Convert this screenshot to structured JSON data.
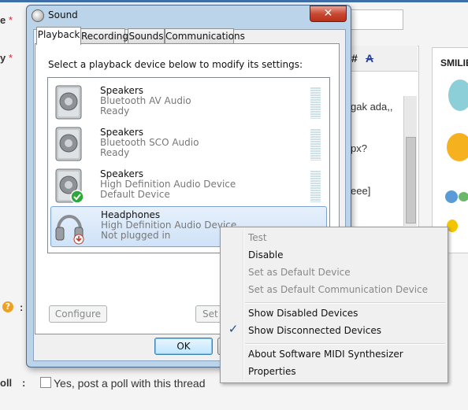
{
  "background": {
    "labels": {
      "row1": "e",
      "row2": "y",
      "req": "*",
      "poll": "oll",
      "colon": ":"
    },
    "title_input_text": "",
    "toolbar": {
      "hash": "#",
      "strike": "A"
    },
    "body_lines": [
      "gak ada,,",
      "px?",
      "eee]"
    ],
    "smilies_heading": "SMILIE",
    "help_icon": "?",
    "poll_option": "Yes, post a poll with this thread"
  },
  "dialog": {
    "title": "Sound",
    "close_label": "✕",
    "tabs": [
      "Playback",
      "Recording",
      "Sounds",
      "Communications"
    ],
    "active_tab": "Playback",
    "instruction": "Select a playback device below to modify its settings:",
    "devices": [
      {
        "name": "Speakers",
        "description": "Bluetooth AV Audio",
        "status": "Ready",
        "icon": "speaker-icon"
      },
      {
        "name": "Speakers",
        "description": "Bluetooth SCO Audio",
        "status": "Ready",
        "icon": "speaker-icon"
      },
      {
        "name": "Speakers",
        "description": "High Definition Audio Device",
        "status": "Default Device",
        "icon": "speaker-default-icon"
      },
      {
        "name": "Headphones",
        "description": "High Definition Audio Device",
        "status": "Not plugged in",
        "icon": "headphones-icon"
      }
    ],
    "buttons": {
      "configure": "Configure",
      "set_default": "Set D",
      "ok": "OK"
    }
  },
  "context_menu": {
    "items": [
      {
        "label": "Test",
        "enabled": false,
        "checked": false
      },
      {
        "label": "Disable",
        "enabled": true,
        "checked": false
      },
      {
        "label": "Set as Default Device",
        "enabled": false,
        "checked": false
      },
      {
        "label": "Set as Default Communication Device",
        "enabled": false,
        "checked": false
      },
      {
        "label": "Show Disabled Devices",
        "enabled": true,
        "checked": false
      },
      {
        "label": "Show Disconnected Devices",
        "enabled": true,
        "checked": true
      },
      {
        "label": "About Software MIDI Synthesizer",
        "enabled": true,
        "checked": false
      },
      {
        "label": "Properties",
        "enabled": true,
        "checked": false
      }
    ],
    "check_glyph": "✓"
  }
}
